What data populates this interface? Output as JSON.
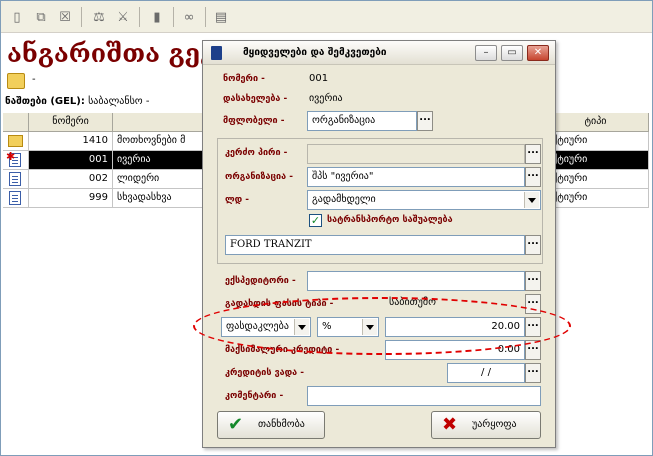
{
  "app": {
    "title": "ანგარიშთა გეგმა",
    "folder_label": "-",
    "section": {
      "label": "ნაშთები (GEL):",
      "value": "საბალანსო -"
    }
  },
  "toolbar": {
    "icons": [
      "new-doc-icon",
      "open-icon",
      "delete-icon",
      "scales-icon",
      "scales-delete-icon",
      "bookmark-icon",
      "binoculars-icon",
      "print-icon"
    ]
  },
  "grid": {
    "columns": [
      "ნომერი",
      "",
      "ტიპი"
    ],
    "rows": [
      {
        "icon": "folder-icon",
        "number": "1410",
        "name": "მოთხოვნები მ",
        "type": "აქტიური"
      },
      {
        "icon": "document-star-icon",
        "number": "001",
        "name": "ივერია",
        "type": "აქტიური"
      },
      {
        "icon": "document-icon",
        "number": "002",
        "name": "ლიდერი",
        "type": "აქტიური"
      },
      {
        "icon": "document-icon",
        "number": "999",
        "name": "სხვადასხვა",
        "type": "აქტიური"
      }
    ]
  },
  "dialog": {
    "title": "მყიდველები და შემკვეთები",
    "number_label": "ნომერი -",
    "number_value": "001",
    "name_label": "დასახელება -",
    "name_value": "ივერია",
    "owner_label": "მფლობელი -",
    "owner_value": "ორგანიზაცია",
    "contact_label": "კერძო პირი -",
    "contact_value": "",
    "org_label": "ორგანიზაცია -",
    "org_value": "შპს \"ივერია\"",
    "group_label": "ლდ -",
    "group_value": "გადამხდელი",
    "checkbox_label": "სატრანსპორტო საშუალება",
    "checkbox_checked": true,
    "vehicle_value": "FORD TRANZIT",
    "expeditor_label": "ექსპედიტორი -",
    "expeditor_value": "",
    "payment_label": "გადახდის ფასის ტიპი -",
    "payment_value": "საბითუმო",
    "discount_type": "ფასდაკლება",
    "discount_unit": "%",
    "discount_value": "20.00",
    "credit_label": "მაქსიმალური კრედიტი -",
    "credit_value": "0.00",
    "credit_term_label": "კრედიტის ვადა -",
    "credit_term_value": "/   /",
    "comment_label": "კომენტარი -",
    "comment_value": "",
    "ok_label": "თანხმობა",
    "cancel_label": "უარყოფა"
  },
  "colors": {
    "title_red": "#7a0000",
    "annotation_red": "#e00000",
    "ok_green": "#14882a",
    "cancel_red": "#c00000"
  }
}
